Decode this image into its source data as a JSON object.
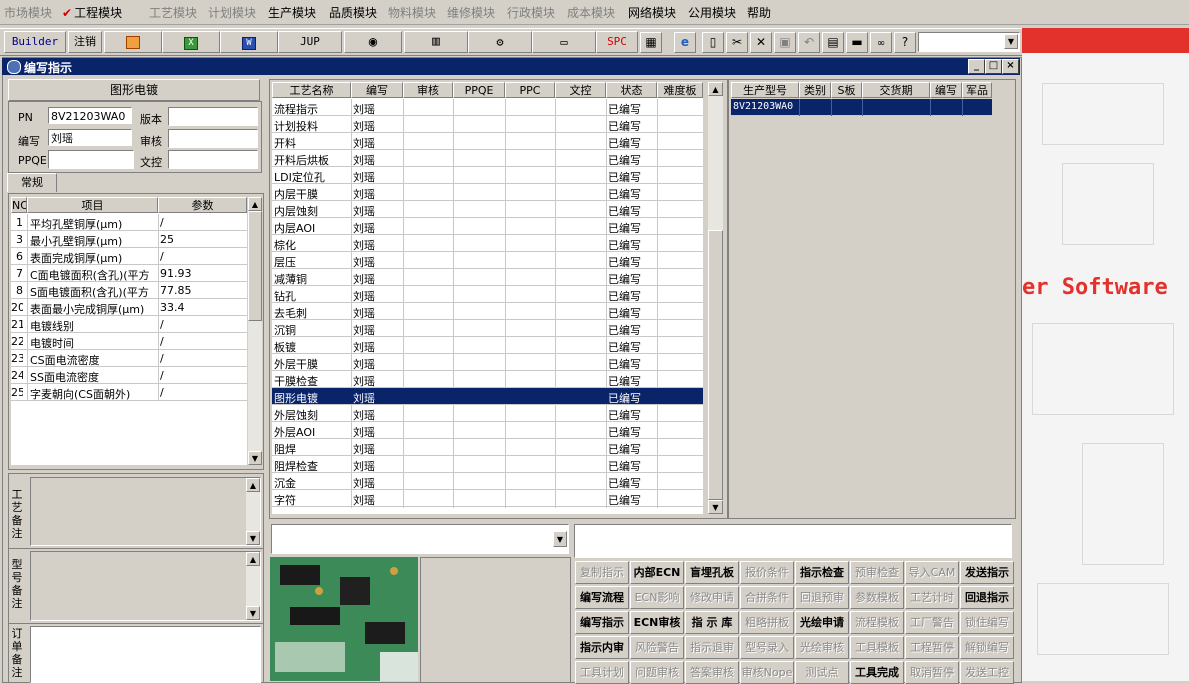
{
  "menubar": {
    "items": [
      {
        "label": "市场模块",
        "enabled": false
      },
      {
        "label": "工程模块",
        "enabled": true,
        "checked": true
      },
      {
        "label": "工艺模块",
        "enabled": false
      },
      {
        "label": "计划模块",
        "enabled": false
      },
      {
        "label": "生产模块",
        "enabled": true
      },
      {
        "label": "品质模块",
        "enabled": true
      },
      {
        "label": "物料模块",
        "enabled": false
      },
      {
        "label": "维修模块",
        "enabled": false
      },
      {
        "label": "行政模块",
        "enabled": false
      },
      {
        "label": "成本模块",
        "enabled": false
      },
      {
        "label": "网络模块",
        "enabled": true
      },
      {
        "label": "公用模块",
        "enabled": true
      },
      {
        "label": "帮助",
        "enabled": true
      }
    ]
  },
  "toolbar": {
    "builder_label": "Builder",
    "logout_label": "注销",
    "jup_label": "JUP",
    "spc_label": "SPC",
    "combo_value": ""
  },
  "background": {
    "software_text": "er Software"
  },
  "window": {
    "title": "编写指示"
  },
  "info": {
    "section_title": "图形电镀",
    "pn_label": "PN",
    "pn_value": "8V21203WA0",
    "version_label": "版本",
    "version_value": "",
    "writer_label": "编写",
    "writer_value": "刘瑶",
    "review_label": "审核",
    "review_value": "",
    "ppqe_label": "PPQE",
    "ppqe_value": "",
    "doc_label": "文控",
    "doc_value": ""
  },
  "params": {
    "tab_label": "常规",
    "headers": {
      "no": "NO",
      "item": "项目",
      "value": "参数"
    },
    "rows": [
      {
        "no": "1",
        "item": "平均孔壁铜厚(μm)",
        "value": "/"
      },
      {
        "no": "3",
        "item": "最小孔壁铜厚(μm)",
        "value": "25"
      },
      {
        "no": "6",
        "item": "表面完成铜厚(μm)",
        "value": "/"
      },
      {
        "no": "7",
        "item": "C面电镀面积(含孔)(平方",
        "value": "91.93"
      },
      {
        "no": "8",
        "item": "S面电镀面积(含孔)(平方",
        "value": "77.85"
      },
      {
        "no": "20",
        "item": "表面最小完成铜厚(μm)",
        "value": "33.4"
      },
      {
        "no": "21",
        "item": "电镀线别",
        "value": "/"
      },
      {
        "no": "22",
        "item": "电镀时间",
        "value": "/"
      },
      {
        "no": "23",
        "item": "CS面电流密度",
        "value": "/"
      },
      {
        "no": "24",
        "item": "SS面电流密度",
        "value": "/"
      },
      {
        "no": "25",
        "item": "字麦朝向(CS面朝外)",
        "value": "/"
      }
    ]
  },
  "notes": {
    "process_label": "工艺备注",
    "model_label": "型号备注",
    "order_label": "订单备注"
  },
  "process_grid": {
    "headers": [
      "工艺名称",
      "编写",
      "审核",
      "PPQE",
      "PPC",
      "文控",
      "状态",
      "难度板"
    ],
    "rows": [
      {
        "name": "流程指示",
        "writer": "刘瑶",
        "status": "已编写"
      },
      {
        "name": "计划投料",
        "writer": "刘瑶",
        "status": "已编写"
      },
      {
        "name": "开料",
        "writer": "刘瑶",
        "status": "已编写"
      },
      {
        "name": "开料后烘板",
        "writer": "刘瑶",
        "status": "已编写"
      },
      {
        "name": "LDI定位孔",
        "writer": "刘瑶",
        "status": "已编写"
      },
      {
        "name": "内层干膜",
        "writer": "刘瑶",
        "status": "已编写"
      },
      {
        "name": "内层蚀刻",
        "writer": "刘瑶",
        "status": "已编写"
      },
      {
        "name": "内层AOI",
        "writer": "刘瑶",
        "status": "已编写"
      },
      {
        "name": "棕化",
        "writer": "刘瑶",
        "status": "已编写"
      },
      {
        "name": "层压",
        "writer": "刘瑶",
        "status": "已编写"
      },
      {
        "name": "减薄铜",
        "writer": "刘瑶",
        "status": "已编写"
      },
      {
        "name": "钻孔",
        "writer": "刘瑶",
        "status": "已编写"
      },
      {
        "name": "去毛刺",
        "writer": "刘瑶",
        "status": "已编写"
      },
      {
        "name": "沉铜",
        "writer": "刘瑶",
        "status": "已编写"
      },
      {
        "name": "板镀",
        "writer": "刘瑶",
        "status": "已编写"
      },
      {
        "name": "外层干膜",
        "writer": "刘瑶",
        "status": "已编写"
      },
      {
        "name": "干膜检查",
        "writer": "刘瑶",
        "status": "已编写"
      },
      {
        "name": "图形电镀",
        "writer": "刘瑶",
        "status": "已编写",
        "selected": true
      },
      {
        "name": "外层蚀刻",
        "writer": "刘瑶",
        "status": "已编写"
      },
      {
        "name": "外层AOI",
        "writer": "刘瑶",
        "status": "已编写"
      },
      {
        "name": "阻焊",
        "writer": "刘瑶",
        "status": "已编写"
      },
      {
        "name": "阻焊检查",
        "writer": "刘瑶",
        "status": "已编写"
      },
      {
        "name": "沉金",
        "writer": "刘瑶",
        "status": "已编写"
      },
      {
        "name": "字符",
        "writer": "刘瑶",
        "status": "已编写"
      }
    ]
  },
  "product_grid": {
    "headers": [
      "生产型号",
      "类别",
      "S板",
      "交货期",
      "编写",
      "军品"
    ],
    "rows": [
      {
        "model": "8V21203WA0"
      }
    ]
  },
  "actions": {
    "rows": [
      [
        {
          "label": "复制指示",
          "enabled": false
        },
        {
          "label": "内部ECN",
          "enabled": true
        },
        {
          "label": "盲埋孔板",
          "enabled": true
        },
        {
          "label": "报价条件",
          "enabled": false
        },
        {
          "label": "指示检查",
          "enabled": true
        },
        {
          "label": "预审检查",
          "enabled": false
        },
        {
          "label": "导入CAM",
          "enabled": false
        },
        {
          "label": "发送指示",
          "enabled": true
        }
      ],
      [
        {
          "label": "编写流程",
          "enabled": true
        },
        {
          "label": "ECN影响",
          "enabled": false
        },
        {
          "label": "修改申请",
          "enabled": false
        },
        {
          "label": "合拼条件",
          "enabled": false
        },
        {
          "label": "回退预审",
          "enabled": false
        },
        {
          "label": "参数模板",
          "enabled": false
        },
        {
          "label": "工艺计时",
          "enabled": false
        },
        {
          "label": "回退指示",
          "enabled": true
        }
      ],
      [
        {
          "label": "编写指示",
          "enabled": true
        },
        {
          "label": "ECN审核",
          "enabled": true
        },
        {
          "label": "指 示 库",
          "enabled": true
        },
        {
          "label": "粗略拼板",
          "enabled": false
        },
        {
          "label": "光绘申请",
          "enabled": true
        },
        {
          "label": "流程模板",
          "enabled": false
        },
        {
          "label": "工厂警告",
          "enabled": false
        },
        {
          "label": "锁住编写",
          "enabled": false
        }
      ],
      [
        {
          "label": "指示内审",
          "enabled": true
        },
        {
          "label": "风险警告",
          "enabled": false
        },
        {
          "label": "指示退审",
          "enabled": false
        },
        {
          "label": "型号录入",
          "enabled": false
        },
        {
          "label": "光绘审核",
          "enabled": false
        },
        {
          "label": "工具模板",
          "enabled": false
        },
        {
          "label": "工程暂停",
          "enabled": false
        },
        {
          "label": "解锁编写",
          "enabled": false
        }
      ],
      [
        {
          "label": "工具计划",
          "enabled": false
        },
        {
          "label": "问题审核",
          "enabled": false
        },
        {
          "label": "答案审核",
          "enabled": false
        },
        {
          "label": "审核Nope",
          "enabled": false
        },
        {
          "label": "测试点",
          "enabled": false
        },
        {
          "label": "工具完成",
          "enabled": true
        },
        {
          "label": "取消暂停",
          "enabled": false
        },
        {
          "label": "发送工控",
          "enabled": false
        }
      ]
    ]
  },
  "colors": {
    "selection": "#0a246a",
    "background_red": "#e3312b",
    "window_face": "#d4d0c8"
  }
}
